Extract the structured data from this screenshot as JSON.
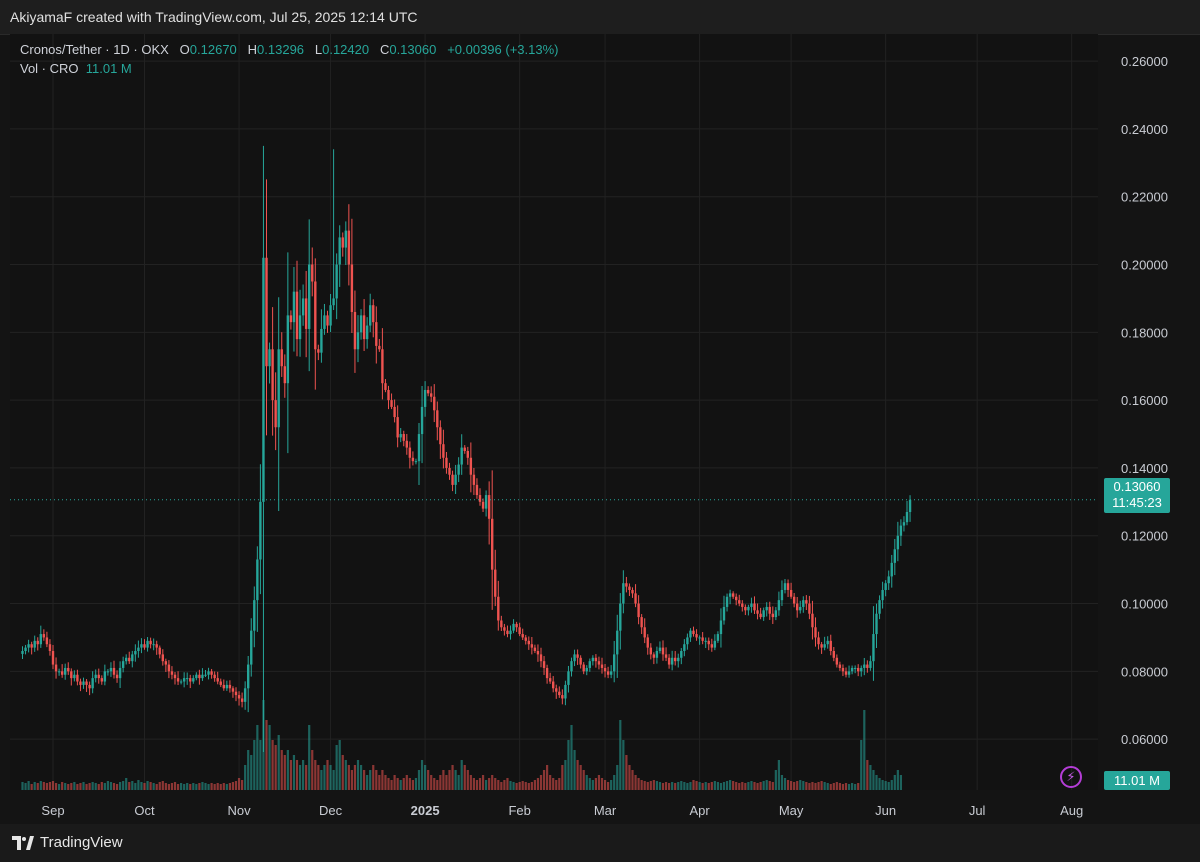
{
  "header": {
    "attribution": "AkiyamaF created with TradingView.com, Jul 25, 2025 12:14 UTC"
  },
  "legend": {
    "symbol": "Cronos/Tether · 1D · OKX",
    "o_label": "O",
    "o_value": "0.12670",
    "h_label": "H",
    "h_value": "0.13296",
    "l_label": "L",
    "l_value": "0.12420",
    "c_label": "C",
    "c_value": "0.13060",
    "change": "+0.00396 (+3.13%)",
    "vol_label": "Vol · CRO",
    "vol_value": "11.01 M"
  },
  "price_tag": {
    "price": "0.13060",
    "countdown": "11:45:23"
  },
  "volume_tag": "11.01 M",
  "footer": {
    "brand": "TradingView"
  },
  "colors": {
    "up": "#26a69a",
    "down": "#ef5350",
    "grid": "#222222",
    "background": "#121212",
    "alert_icon": "#b43dd6"
  },
  "icons": {
    "brand_logo": "tradingview-logo-icon",
    "alert": "lightning-icon"
  },
  "chart_data": {
    "type": "candlestick",
    "interval": "1D",
    "exchange": "OKX",
    "ylim": [
      0.045,
      0.268
    ],
    "y_ticks": [
      "0.26000",
      "0.24000",
      "0.22000",
      "0.20000",
      "0.18000",
      "0.16000",
      "0.14000",
      "0.12000",
      "0.10000",
      "0.08000",
      "0.06000"
    ],
    "y_tick_values": [
      0.26,
      0.24,
      0.22,
      0.2,
      0.18,
      0.16,
      0.14,
      0.12,
      0.1,
      0.08,
      0.06
    ],
    "x_ticks": [
      {
        "label": "Sep",
        "day": 0
      },
      {
        "label": "Oct",
        "day": 30
      },
      {
        "label": "Nov",
        "day": 61
      },
      {
        "label": "Dec",
        "day": 91
      },
      {
        "label": "2025",
        "day": 122,
        "bold": true
      },
      {
        "label": "Feb",
        "day": 153
      },
      {
        "label": "Mar",
        "day": 181
      },
      {
        "label": "Apr",
        "day": 212
      },
      {
        "label": "May",
        "day": 242
      },
      {
        "label": "Jun",
        "day": 273
      },
      {
        "label": "Jul",
        "day": 303
      },
      {
        "label": "Aug",
        "day": 334
      }
    ],
    "first_day_offset": -10,
    "last_price": 0.1306,
    "closes": [
      0.086,
      0.087,
      0.088,
      0.087,
      0.089,
      0.088,
      0.091,
      0.09,
      0.088,
      0.086,
      0.082,
      0.08,
      0.08,
      0.079,
      0.081,
      0.08,
      0.078,
      0.079,
      0.077,
      0.076,
      0.077,
      0.076,
      0.075,
      0.078,
      0.079,
      0.078,
      0.077,
      0.08,
      0.08,
      0.081,
      0.079,
      0.078,
      0.081,
      0.083,
      0.084,
      0.083,
      0.085,
      0.086,
      0.087,
      0.088,
      0.087,
      0.089,
      0.088,
      0.088,
      0.087,
      0.085,
      0.083,
      0.082,
      0.08,
      0.079,
      0.078,
      0.077,
      0.077,
      0.078,
      0.078,
      0.077,
      0.078,
      0.079,
      0.078,
      0.079,
      0.079,
      0.08,
      0.079,
      0.078,
      0.077,
      0.076,
      0.075,
      0.076,
      0.075,
      0.074,
      0.073,
      0.072,
      0.071,
      0.075,
      0.082,
      0.092,
      0.101,
      0.113,
      0.13,
      0.202,
      0.17,
      0.175,
      0.16,
      0.152,
      0.175,
      0.17,
      0.165,
      0.185,
      0.183,
      0.192,
      0.178,
      0.185,
      0.19,
      0.181,
      0.2,
      0.195,
      0.175,
      0.174,
      0.181,
      0.185,
      0.182,
      0.188,
      0.19,
      0.2,
      0.208,
      0.205,
      0.21,
      0.2,
      0.186,
      0.175,
      0.18,
      0.185,
      0.178,
      0.182,
      0.188,
      0.183,
      0.176,
      0.175,
      0.165,
      0.163,
      0.16,
      0.158,
      0.155,
      0.149,
      0.15,
      0.148,
      0.146,
      0.143,
      0.142,
      0.142,
      0.15,
      0.158,
      0.163,
      0.162,
      0.161,
      0.157,
      0.152,
      0.147,
      0.143,
      0.14,
      0.138,
      0.135,
      0.138,
      0.141,
      0.146,
      0.145,
      0.143,
      0.138,
      0.135,
      0.132,
      0.13,
      0.128,
      0.132,
      0.125,
      0.11,
      0.102,
      0.095,
      0.093,
      0.092,
      0.091,
      0.092,
      0.094,
      0.093,
      0.091,
      0.09,
      0.089,
      0.088,
      0.087,
      0.086,
      0.085,
      0.083,
      0.081,
      0.078,
      0.077,
      0.075,
      0.074,
      0.073,
      0.072,
      0.076,
      0.08,
      0.083,
      0.085,
      0.084,
      0.082,
      0.08,
      0.081,
      0.083,
      0.084,
      0.083,
      0.082,
      0.081,
      0.08,
      0.079,
      0.08,
      0.085,
      0.092,
      0.1,
      0.106,
      0.105,
      0.104,
      0.103,
      0.1,
      0.096,
      0.093,
      0.09,
      0.087,
      0.085,
      0.084,
      0.086,
      0.087,
      0.085,
      0.084,
      0.082,
      0.084,
      0.083,
      0.084,
      0.086,
      0.088,
      0.09,
      0.092,
      0.091,
      0.09,
      0.09,
      0.089,
      0.089,
      0.088,
      0.087,
      0.089,
      0.091,
      0.095,
      0.099,
      0.102,
      0.103,
      0.102,
      0.101,
      0.1,
      0.099,
      0.098,
      0.099,
      0.1,
      0.098,
      0.097,
      0.096,
      0.098,
      0.099,
      0.097,
      0.096,
      0.098,
      0.101,
      0.104,
      0.106,
      0.104,
      0.102,
      0.1,
      0.098,
      0.099,
      0.101,
      0.1,
      0.097,
      0.093,
      0.09,
      0.088,
      0.087,
      0.088,
      0.089,
      0.086,
      0.084,
      0.082,
      0.081,
      0.08,
      0.079,
      0.08,
      0.081,
      0.081,
      0.08,
      0.081,
      0.082,
      0.081,
      0.083,
      0.091,
      0.097,
      0.101,
      0.104,
      0.106,
      0.108,
      0.112,
      0.116,
      0.12,
      0.123,
      0.124,
      0.127,
      0.1306
    ],
    "volumes": [
      0.8,
      0.7,
      0.9,
      0.6,
      0.8,
      0.7,
      0.9,
      0.8,
      0.7,
      0.8,
      0.9,
      0.7,
      0.6,
      0.8,
      0.7,
      0.6,
      0.7,
      0.8,
      0.6,
      0.7,
      0.8,
      0.6,
      0.7,
      0.8,
      0.7,
      0.6,
      0.8,
      0.7,
      0.9,
      0.8,
      0.7,
      0.6,
      0.8,
      0.9,
      1.2,
      0.8,
      0.9,
      0.7,
      1.0,
      0.8,
      0.7,
      0.9,
      0.8,
      0.7,
      0.6,
      0.8,
      0.9,
      0.7,
      0.6,
      0.7,
      0.8,
      0.6,
      0.7,
      0.6,
      0.7,
      0.6,
      0.7,
      0.6,
      0.7,
      0.8,
      0.7,
      0.6,
      0.7,
      0.6,
      0.7,
      0.6,
      0.7,
      0.6,
      0.7,
      0.8,
      0.9,
      1.2,
      1.0,
      2.5,
      4.0,
      3.5,
      5.0,
      6.5,
      5.0,
      9.0,
      7.0,
      6.5,
      5.0,
      4.5,
      5.5,
      4.0,
      3.5,
      4.0,
      3.0,
      3.5,
      3.0,
      2.5,
      3.0,
      2.5,
      6.5,
      4.0,
      3.0,
      2.5,
      2.0,
      2.5,
      3.0,
      2.5,
      2.0,
      4.5,
      5.0,
      3.5,
      3.0,
      2.5,
      2.0,
      2.5,
      3.0,
      2.5,
      2.0,
      1.5,
      2.0,
      2.5,
      2.0,
      1.5,
      2.0,
      1.5,
      1.2,
      1.0,
      1.5,
      1.2,
      1.0,
      1.2,
      1.5,
      1.2,
      1.0,
      1.2,
      2.0,
      3.0,
      2.5,
      2.0,
      1.5,
      1.2,
      1.0,
      1.5,
      2.0,
      1.5,
      2.0,
      2.5,
      2.0,
      1.5,
      3.0,
      2.5,
      2.0,
      1.5,
      1.2,
      1.0,
      1.2,
      1.5,
      1.0,
      1.2,
      1.5,
      1.2,
      1.0,
      0.8,
      1.0,
      1.2,
      0.9,
      0.8,
      0.7,
      0.8,
      0.9,
      0.8,
      0.7,
      0.8,
      1.0,
      1.2,
      1.5,
      2.0,
      2.5,
      1.5,
      1.2,
      1.0,
      1.2,
      2.5,
      3.0,
      5.0,
      6.5,
      4.0,
      3.0,
      2.5,
      2.0,
      1.5,
      1.2,
      1.0,
      1.2,
      1.5,
      1.2,
      1.0,
      0.8,
      1.0,
      1.5,
      2.5,
      7.0,
      5.0,
      3.5,
      2.5,
      2.0,
      1.5,
      1.2,
      1.0,
      0.9,
      0.8,
      0.9,
      1.0,
      0.9,
      0.8,
      0.7,
      0.8,
      0.7,
      0.8,
      0.7,
      0.8,
      0.9,
      0.8,
      0.7,
      0.8,
      1.0,
      0.9,
      0.8,
      0.7,
      0.8,
      0.7,
      0.8,
      0.9,
      0.8,
      0.7,
      0.8,
      0.9,
      1.0,
      0.9,
      0.8,
      0.7,
      0.8,
      0.7,
      0.8,
      0.9,
      0.8,
      0.7,
      0.8,
      0.9,
      1.0,
      0.9,
      0.8,
      2.0,
      3.0,
      1.5,
      1.2,
      1.0,
      0.9,
      0.8,
      0.9,
      1.0,
      0.9,
      0.8,
      0.7,
      0.8,
      0.7,
      0.8,
      0.9,
      0.8,
      0.7,
      0.6,
      0.7,
      0.8,
      0.7,
      0.6,
      0.7,
      0.6,
      0.7,
      0.6,
      0.7,
      5.0,
      8.0,
      3.0,
      2.5,
      2.0,
      1.5,
      1.2,
      1.0,
      0.9,
      0.8,
      1.0,
      1.5,
      2.0,
      1.5
    ]
  }
}
